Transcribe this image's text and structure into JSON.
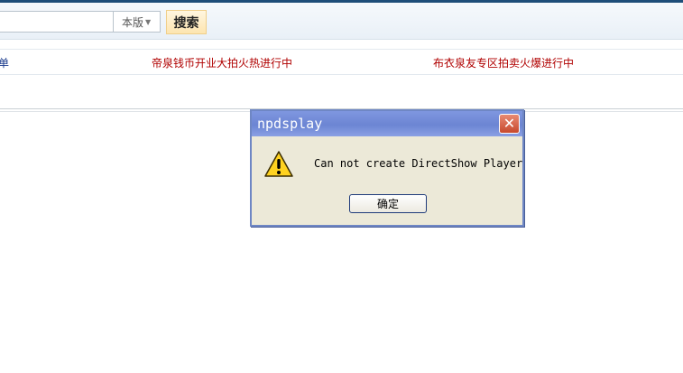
{
  "search": {
    "input_value": "",
    "scope_label": "本版",
    "button_label": "搜索"
  },
  "news": [
    {
      "text": "单"
    },
    {
      "text": "帝泉钱币开业大拍火热进行中"
    },
    {
      "text": "布衣泉友专区拍卖火爆进行中"
    }
  ],
  "dialog": {
    "title": "npdsplay",
    "message": "Can not create DirectShow Player",
    "ok_label": "确定",
    "close_glyph": "✕",
    "icon": "warning-icon"
  },
  "colors": {
    "news_link_blue": "#1a3a8c",
    "news_link_red": "#b00000",
    "dialog_title_bar": "#6c85d3",
    "dialog_body": "#ece9d8"
  }
}
